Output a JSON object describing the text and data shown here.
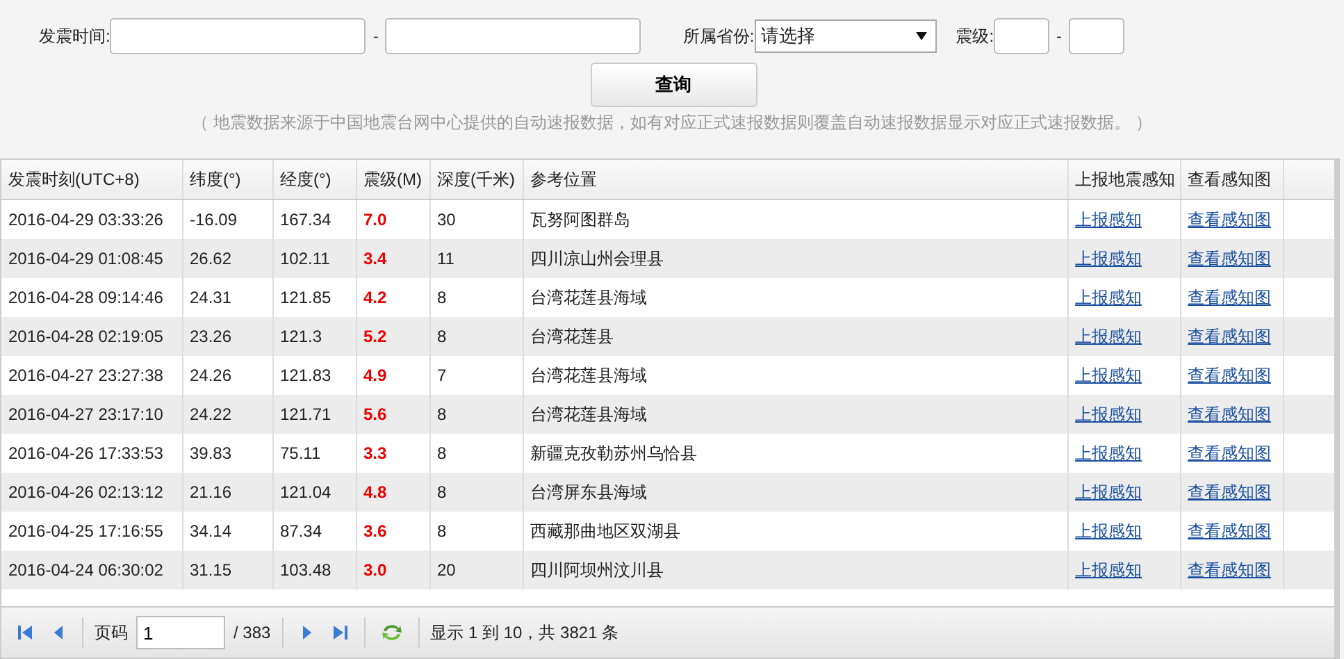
{
  "filters": {
    "time_label": "发震时间:",
    "time_separator": "-",
    "province_label": "所属省份:",
    "province_value": "请选择",
    "magnitude_label": "震级:",
    "magnitude_separator": "-",
    "search_button": "查询",
    "note": "（ 地震数据来源于中国地震台网中心提供的自动速报数据，如有对应正式速报数据则覆盖自动速报数据显示对应正式速报数据。 ）"
  },
  "table": {
    "columns": [
      "发震时刻(UTC+8)",
      "纬度(°)",
      "经度(°)",
      "震级(M)",
      "深度(千米)",
      "参考位置",
      "上报地震感知",
      "查看感知图"
    ],
    "rows": [
      {
        "time": "2016-04-29 03:33:26",
        "lat": "-16.09",
        "lon": "167.34",
        "mag": "7.0",
        "depth": "30",
        "location": "瓦努阿图群岛",
        "report": "上报感知",
        "view": "查看感知图"
      },
      {
        "time": "2016-04-29 01:08:45",
        "lat": "26.62",
        "lon": "102.11",
        "mag": "3.4",
        "depth": "11",
        "location": "四川凉山州会理县",
        "report": "上报感知",
        "view": "查看感知图"
      },
      {
        "time": "2016-04-28 09:14:46",
        "lat": "24.31",
        "lon": "121.85",
        "mag": "4.2",
        "depth": "8",
        "location": "台湾花莲县海域",
        "report": "上报感知",
        "view": "查看感知图"
      },
      {
        "time": "2016-04-28 02:19:05",
        "lat": "23.26",
        "lon": "121.3",
        "mag": "5.2",
        "depth": "8",
        "location": "台湾花莲县",
        "report": "上报感知",
        "view": "查看感知图"
      },
      {
        "time": "2016-04-27 23:27:38",
        "lat": "24.26",
        "lon": "121.83",
        "mag": "4.9",
        "depth": "7",
        "location": "台湾花莲县海域",
        "report": "上报感知",
        "view": "查看感知图"
      },
      {
        "time": "2016-04-27 23:17:10",
        "lat": "24.22",
        "lon": "121.71",
        "mag": "5.6",
        "depth": "8",
        "location": "台湾花莲县海域",
        "report": "上报感知",
        "view": "查看感知图"
      },
      {
        "time": "2016-04-26 17:33:53",
        "lat": "39.83",
        "lon": "75.11",
        "mag": "3.3",
        "depth": "8",
        "location": "新疆克孜勒苏州乌恰县",
        "report": "上报感知",
        "view": "查看感知图"
      },
      {
        "time": "2016-04-26 02:13:12",
        "lat": "21.16",
        "lon": "121.04",
        "mag": "4.8",
        "depth": "8",
        "location": "台湾屏东县海域",
        "report": "上报感知",
        "view": "查看感知图"
      },
      {
        "time": "2016-04-25 17:16:55",
        "lat": "34.14",
        "lon": "87.34",
        "mag": "3.6",
        "depth": "8",
        "location": "西藏那曲地区双湖县",
        "report": "上报感知",
        "view": "查看感知图"
      },
      {
        "time": "2016-04-24 06:30:02",
        "lat": "31.15",
        "lon": "103.48",
        "mag": "3.0",
        "depth": "20",
        "location": "四川阿坝州汶川县",
        "report": "上报感知",
        "view": "查看感知图"
      }
    ]
  },
  "pager": {
    "page_label": "页码",
    "page_value": "1",
    "total_pages": "/ 383",
    "summary": "显示 1 到 10，共 3821 条"
  }
}
